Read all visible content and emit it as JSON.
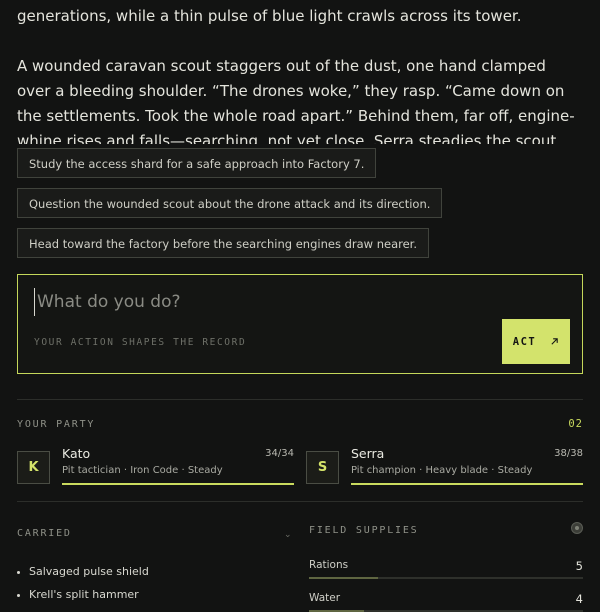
{
  "story": {
    "paragraph_1": "generations, while a thin pulse of blue light crawls across its tower.",
    "paragraph_2": "A wounded caravan scout staggers out of the dust, one hand clamped over a bleeding shoulder. “The drones woke,” they rasp. “Came down on the settlements. Took the whole road apart.” Behind them, far off, engine-whine rises and falls—searching, not yet close. Serra steadies the scout while Kato spots a small shard of"
  },
  "choices": [
    "Study the access shard for a safe approach into Factory 7.",
    "Question the wounded scout about the drone attack and its direction.",
    "Head toward the factory before the searching engines draw nearer."
  ],
  "action_input": {
    "placeholder": "What do you do?",
    "value": "",
    "hint": "YOUR ACTION SHAPES THE RECORD",
    "button_label": "ACT",
    "button_icon": "arrow-up-right-icon"
  },
  "party": {
    "label": "YOUR PARTY",
    "count": "02",
    "members": [
      {
        "initial": "K",
        "name": "Kato",
        "hp": "34/34",
        "hp_fraction": 1.0,
        "description": "Pit tactician · Iron Code · Steady"
      },
      {
        "initial": "S",
        "name": "Serra",
        "hp": "38/38",
        "hp_fraction": 1.0,
        "description": "Pit champion · Heavy blade · Steady"
      }
    ]
  },
  "carried": {
    "label": "CARRIED",
    "items": [
      "Salvaged pulse shield",
      "Krell's split hammer"
    ]
  },
  "field_supplies": {
    "label": "FIELD SUPPLIES",
    "items": [
      {
        "name": "Rations",
        "value": "5",
        "fraction": 0.25
      },
      {
        "name": "Water",
        "value": "4",
        "fraction": 0.2
      }
    ]
  },
  "colors": {
    "accent": "#d3e36c",
    "background": "#121312",
    "border": "#40433c"
  }
}
